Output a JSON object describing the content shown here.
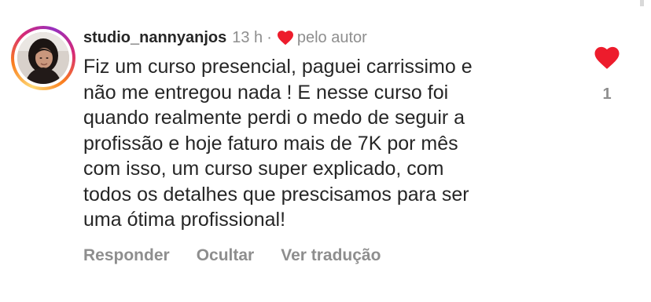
{
  "comment": {
    "username": "studio_nannyanjos",
    "time": "13 h",
    "separator": "·",
    "liked_by_author_label": "pelo autor",
    "text": "Fiz um curso presencial, paguei carrissimo e\nnão me entregou nada ! E nesse curso foi\nquando realmente perdi o medo de seguir a\nprofissão e hoje faturo mais de 7K por mês\ncom isso, um curso super explicado, com\ntodos os detalhes que prescisamos para ser\numa ótima profissional!",
    "likes": "1",
    "actions": {
      "reply": "Responder",
      "hide": "Ocultar",
      "translate": "Ver tradução"
    }
  },
  "icons": {
    "like": "heart-icon",
    "author_like": "heart-icon"
  },
  "colors": {
    "heart_red": "#ed1c2c",
    "muted_text": "#8e8e8e",
    "username_text": "#262626"
  }
}
